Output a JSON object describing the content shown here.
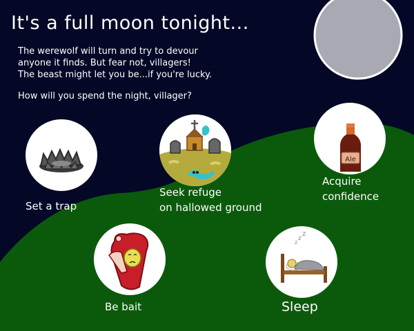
{
  "title": "It's a full moon tonight...",
  "intro": [
    "The werewolf will turn and try to devour",
    "anyone it finds. But fear not, villagers!",
    "The beast might let you be...if you're lucky."
  ],
  "question": "How will you spend the night, villager?",
  "choices": {
    "trap": {
      "label": "Set a trap",
      "icon": "bear-trap-icon"
    },
    "refuge": {
      "label_line1": "Seek refuge",
      "label_line2": "on hallowed ground",
      "icon": "graveyard-icon"
    },
    "confidence": {
      "label_line1": "Acquire",
      "label_line2": "confidence",
      "icon": "ale-bottle-icon",
      "bottle_text": "Ale"
    },
    "bait": {
      "label": "Be bait",
      "icon": "meat-bait-icon"
    },
    "sleep": {
      "label": "Sleep",
      "icon": "sleeping-in-bed-icon"
    }
  },
  "colors": {
    "sky": "#040826",
    "hill": "#0b5a0b",
    "moon": "#a9a9b4",
    "moon_outline": "#ffffff",
    "choice_circle": "#ffffff",
    "text": "#ffffff"
  }
}
